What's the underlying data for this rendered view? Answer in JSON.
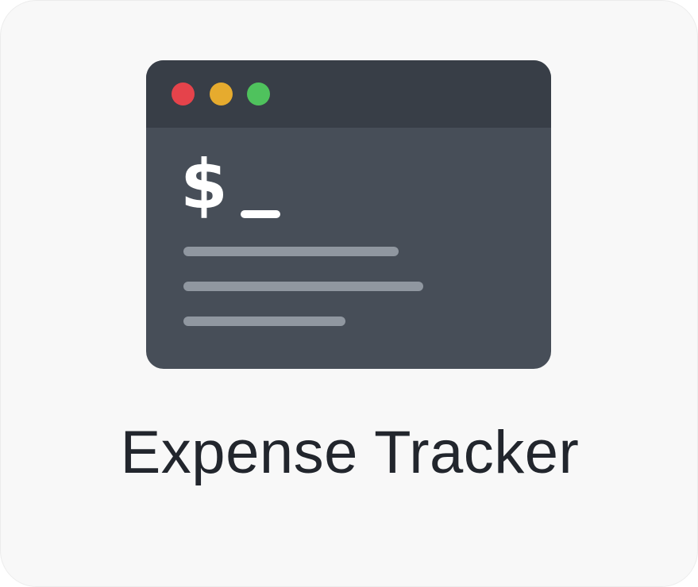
{
  "app": {
    "title": "Expense Tracker"
  },
  "terminal_icon": {
    "prompt_symbol": "$",
    "window_controls": [
      "close-dot",
      "minimize-dot",
      "maximize-dot"
    ],
    "colors": {
      "window_body": "#474e58",
      "title_bar": "#383e47",
      "close": "#e5434b",
      "minimize": "#e6ab2e",
      "maximize": "#4fc25d",
      "text_lines": "#9097a0"
    }
  }
}
